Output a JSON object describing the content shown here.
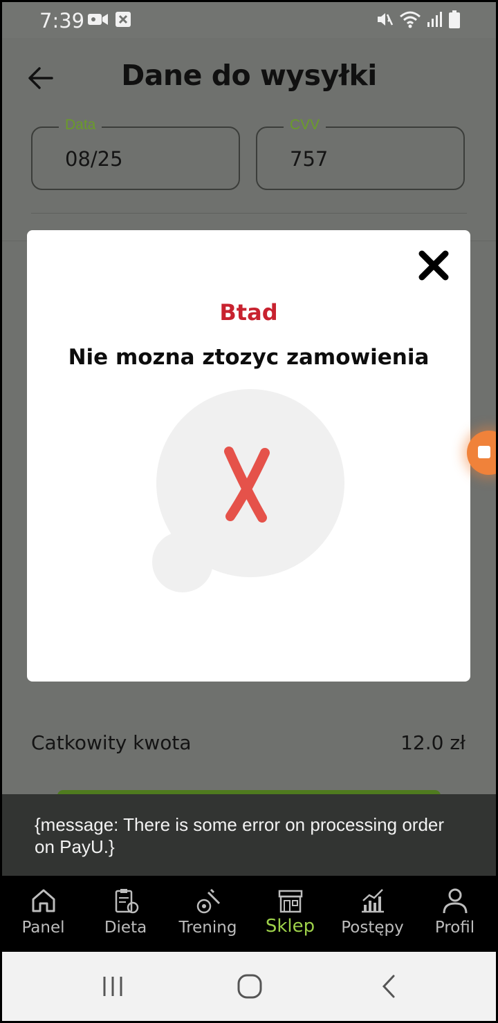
{
  "status_bar": {
    "time": "7:39",
    "left_icons": [
      "video-camera-icon",
      "close-square-icon"
    ],
    "right_icons": [
      "mute-icon",
      "wifi-icon",
      "signal-icon",
      "battery-icon"
    ]
  },
  "header": {
    "title": "Dane do wysyłki"
  },
  "form": {
    "date_label": "Data",
    "date_value": "08/25",
    "cvv_label": "CVV",
    "cvv_value": "757"
  },
  "summary": {
    "total_label": "Catkowity kwota",
    "total_value": "12.0 zł"
  },
  "modal": {
    "title": "Btad",
    "message": "Nie mozna ztozyc zamowienia"
  },
  "snackbar": {
    "text": "{message: There is some error on processing order on PayU.}"
  },
  "bottom_nav": {
    "items": [
      {
        "label": "Panel",
        "icon": "home-icon"
      },
      {
        "label": "Dieta",
        "icon": "diet-clipboard-icon"
      },
      {
        "label": "Trening",
        "icon": "training-icon"
      },
      {
        "label": "Sklep",
        "icon": "shop-icon"
      },
      {
        "label": "Postępy",
        "icon": "progress-chart-icon"
      },
      {
        "label": "Profil",
        "icon": "profile-icon"
      }
    ],
    "active_label": "Sklep"
  },
  "colors": {
    "accent_green": "#9ed14a",
    "legend_green": "#6a9c2a",
    "error_red": "#c8222f",
    "x_red": "#e5524a"
  }
}
